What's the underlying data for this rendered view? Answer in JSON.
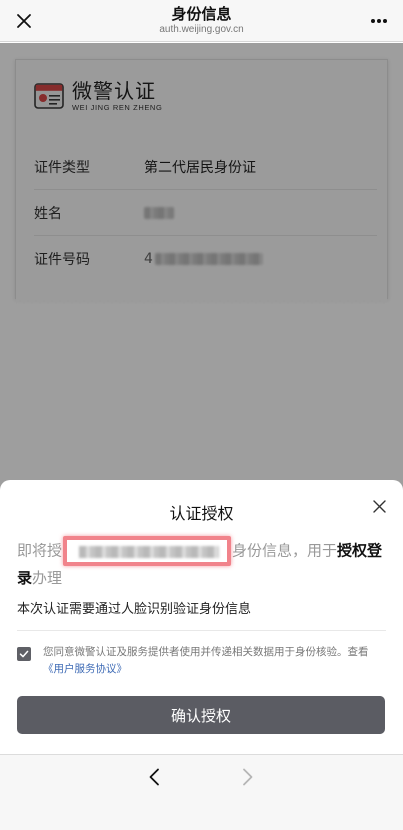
{
  "navbar": {
    "title": "身份信息",
    "subtitle": "auth.weijing.gov.cn",
    "close_icon": "close-icon",
    "more_icon": "more-icon"
  },
  "certificate": {
    "brand_cn": "微警认证",
    "brand_en": "WEI  JING REN ZHENG",
    "rows": [
      {
        "label": "证件类型",
        "value": "第二代居民身份证"
      },
      {
        "label": "姓名",
        "value": ""
      },
      {
        "label": "证件号码",
        "value": "4"
      }
    ]
  },
  "sheet": {
    "title": "认证授权",
    "desc_prefix": "即将授",
    "desc_middle": "身份信息，用于",
    "desc_strong_1": "授权登",
    "desc_strong_2": "录",
    "desc_suffix": "办理",
    "face_note": "本次认证需要通过人脸识别验证身份信息",
    "agree_text": "您同意微警认证及服务提供者使用并传递相关数据用于身份核验。查看",
    "agree_link": "《用户服务协议》",
    "agree_checked": true,
    "confirm_label": "确认授权"
  },
  "browser": {
    "back_icon": "back-arrow-icon",
    "forward_icon": "forward-arrow-icon"
  },
  "colors": {
    "button_bg": "#5b5c63",
    "link": "#3d6ab5",
    "highlight": "#ec5a64"
  }
}
